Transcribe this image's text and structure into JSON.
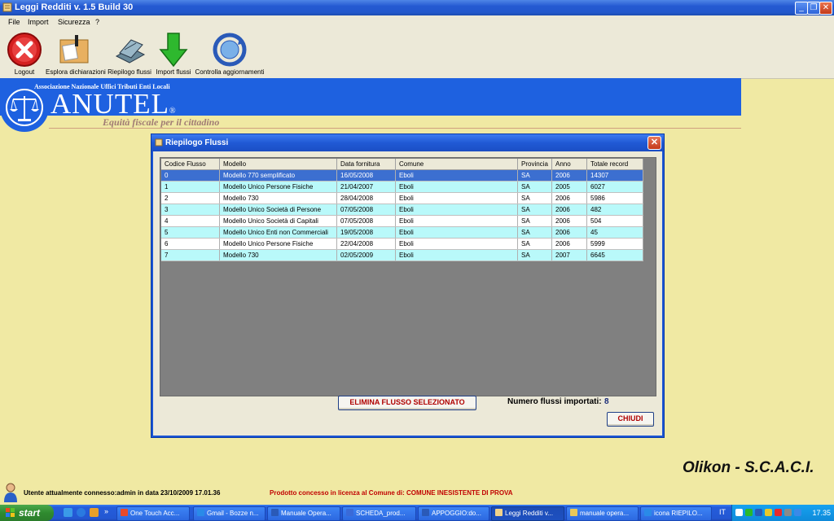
{
  "window": {
    "title": "Leggi Redditi  v. 1.5 Build 30"
  },
  "menu": [
    "File",
    "Import",
    "Sicurezza",
    "?"
  ],
  "toolbar": [
    {
      "label": "Logout",
      "icon": "logout-icon"
    },
    {
      "label": "Esplora dichiarazioni",
      "icon": "explore-icon"
    },
    {
      "label": "Riepilogo flussi",
      "icon": "summary-icon"
    },
    {
      "label": "Import flussi",
      "icon": "import-icon"
    },
    {
      "label": "Controlla aggiornamenti",
      "icon": "update-icon"
    }
  ],
  "banner": {
    "association": "Associazione Nazionale Uffici Tributi Enti Locali",
    "brand": "ANUTEL",
    "registered": "®",
    "slogan": "Equità fiscale per il cittadino"
  },
  "dialog": {
    "title": "Riepilogo Flussi",
    "columns": [
      "Codice Flusso",
      "Modello",
      "Data fornitura",
      "Comune",
      "Provincia",
      "Anno",
      "Totale record"
    ],
    "rows": [
      [
        "0",
        "Modello 770 semplificato",
        "16/05/2008",
        "Eboli",
        "SA",
        "2006",
        "14307"
      ],
      [
        "1",
        "Modello Unico Persone Fisiche",
        "21/04/2007",
        "Eboli",
        "SA",
        "2005",
        "6027"
      ],
      [
        "2",
        "Modello 730",
        "28/04/2008",
        "Eboli",
        "SA",
        "2006",
        "5986"
      ],
      [
        "3",
        "Modello Unico Società di Persone",
        "07/05/2008",
        "Eboli",
        "SA",
        "2006",
        "482"
      ],
      [
        "4",
        "Modello Unico Società di Capitali",
        "07/05/2008",
        "Eboli",
        "SA",
        "2006",
        "504"
      ],
      [
        "5",
        "Modello Unico Enti non Commerciali",
        "19/05/2008",
        "Eboli",
        "SA",
        "2006",
        "45"
      ],
      [
        "6",
        "Modello Unico Persone Fisiche",
        "22/04/2008",
        "Eboli",
        "SA",
        "2006",
        "5999"
      ],
      [
        "7",
        "Modello 730",
        "02/05/2009",
        "Eboli",
        "SA",
        "2007",
        "6645"
      ]
    ],
    "selected_row": 0,
    "delete_button": "ELIMINA FLUSSO SELEZIONATO",
    "count_label": "Numero flussi importati:",
    "count_value": "8",
    "close_button": "CHIUDI"
  },
  "credit": "Olikon - S.C.A.C.I.",
  "status": {
    "user": "Utente attualmente connesso:admin in data 23/10/2009 17.01.36",
    "license": "Prodotto concesso in licenza al Comune di: COMUNE INESISTENTE DI PROVA"
  },
  "taskbar": {
    "start": "start",
    "tasks": [
      "One Touch Acc...",
      "Gmail - Bozze n...",
      "Manuale Opera...",
      "SCHEDA_prod...",
      "APPOGGIO:do...",
      "Leggi Redditi  v...",
      "manuale opera...",
      "icona RIEPILO..."
    ],
    "active_task": 5,
    "lang": "IT",
    "clock": "17.35"
  },
  "colors": {
    "banner": "#1e61e0",
    "background": "#f0e9a3",
    "selected_row": "#3c6fd0",
    "alt_row": "#b9f9fa",
    "license_text": "#c00000"
  }
}
